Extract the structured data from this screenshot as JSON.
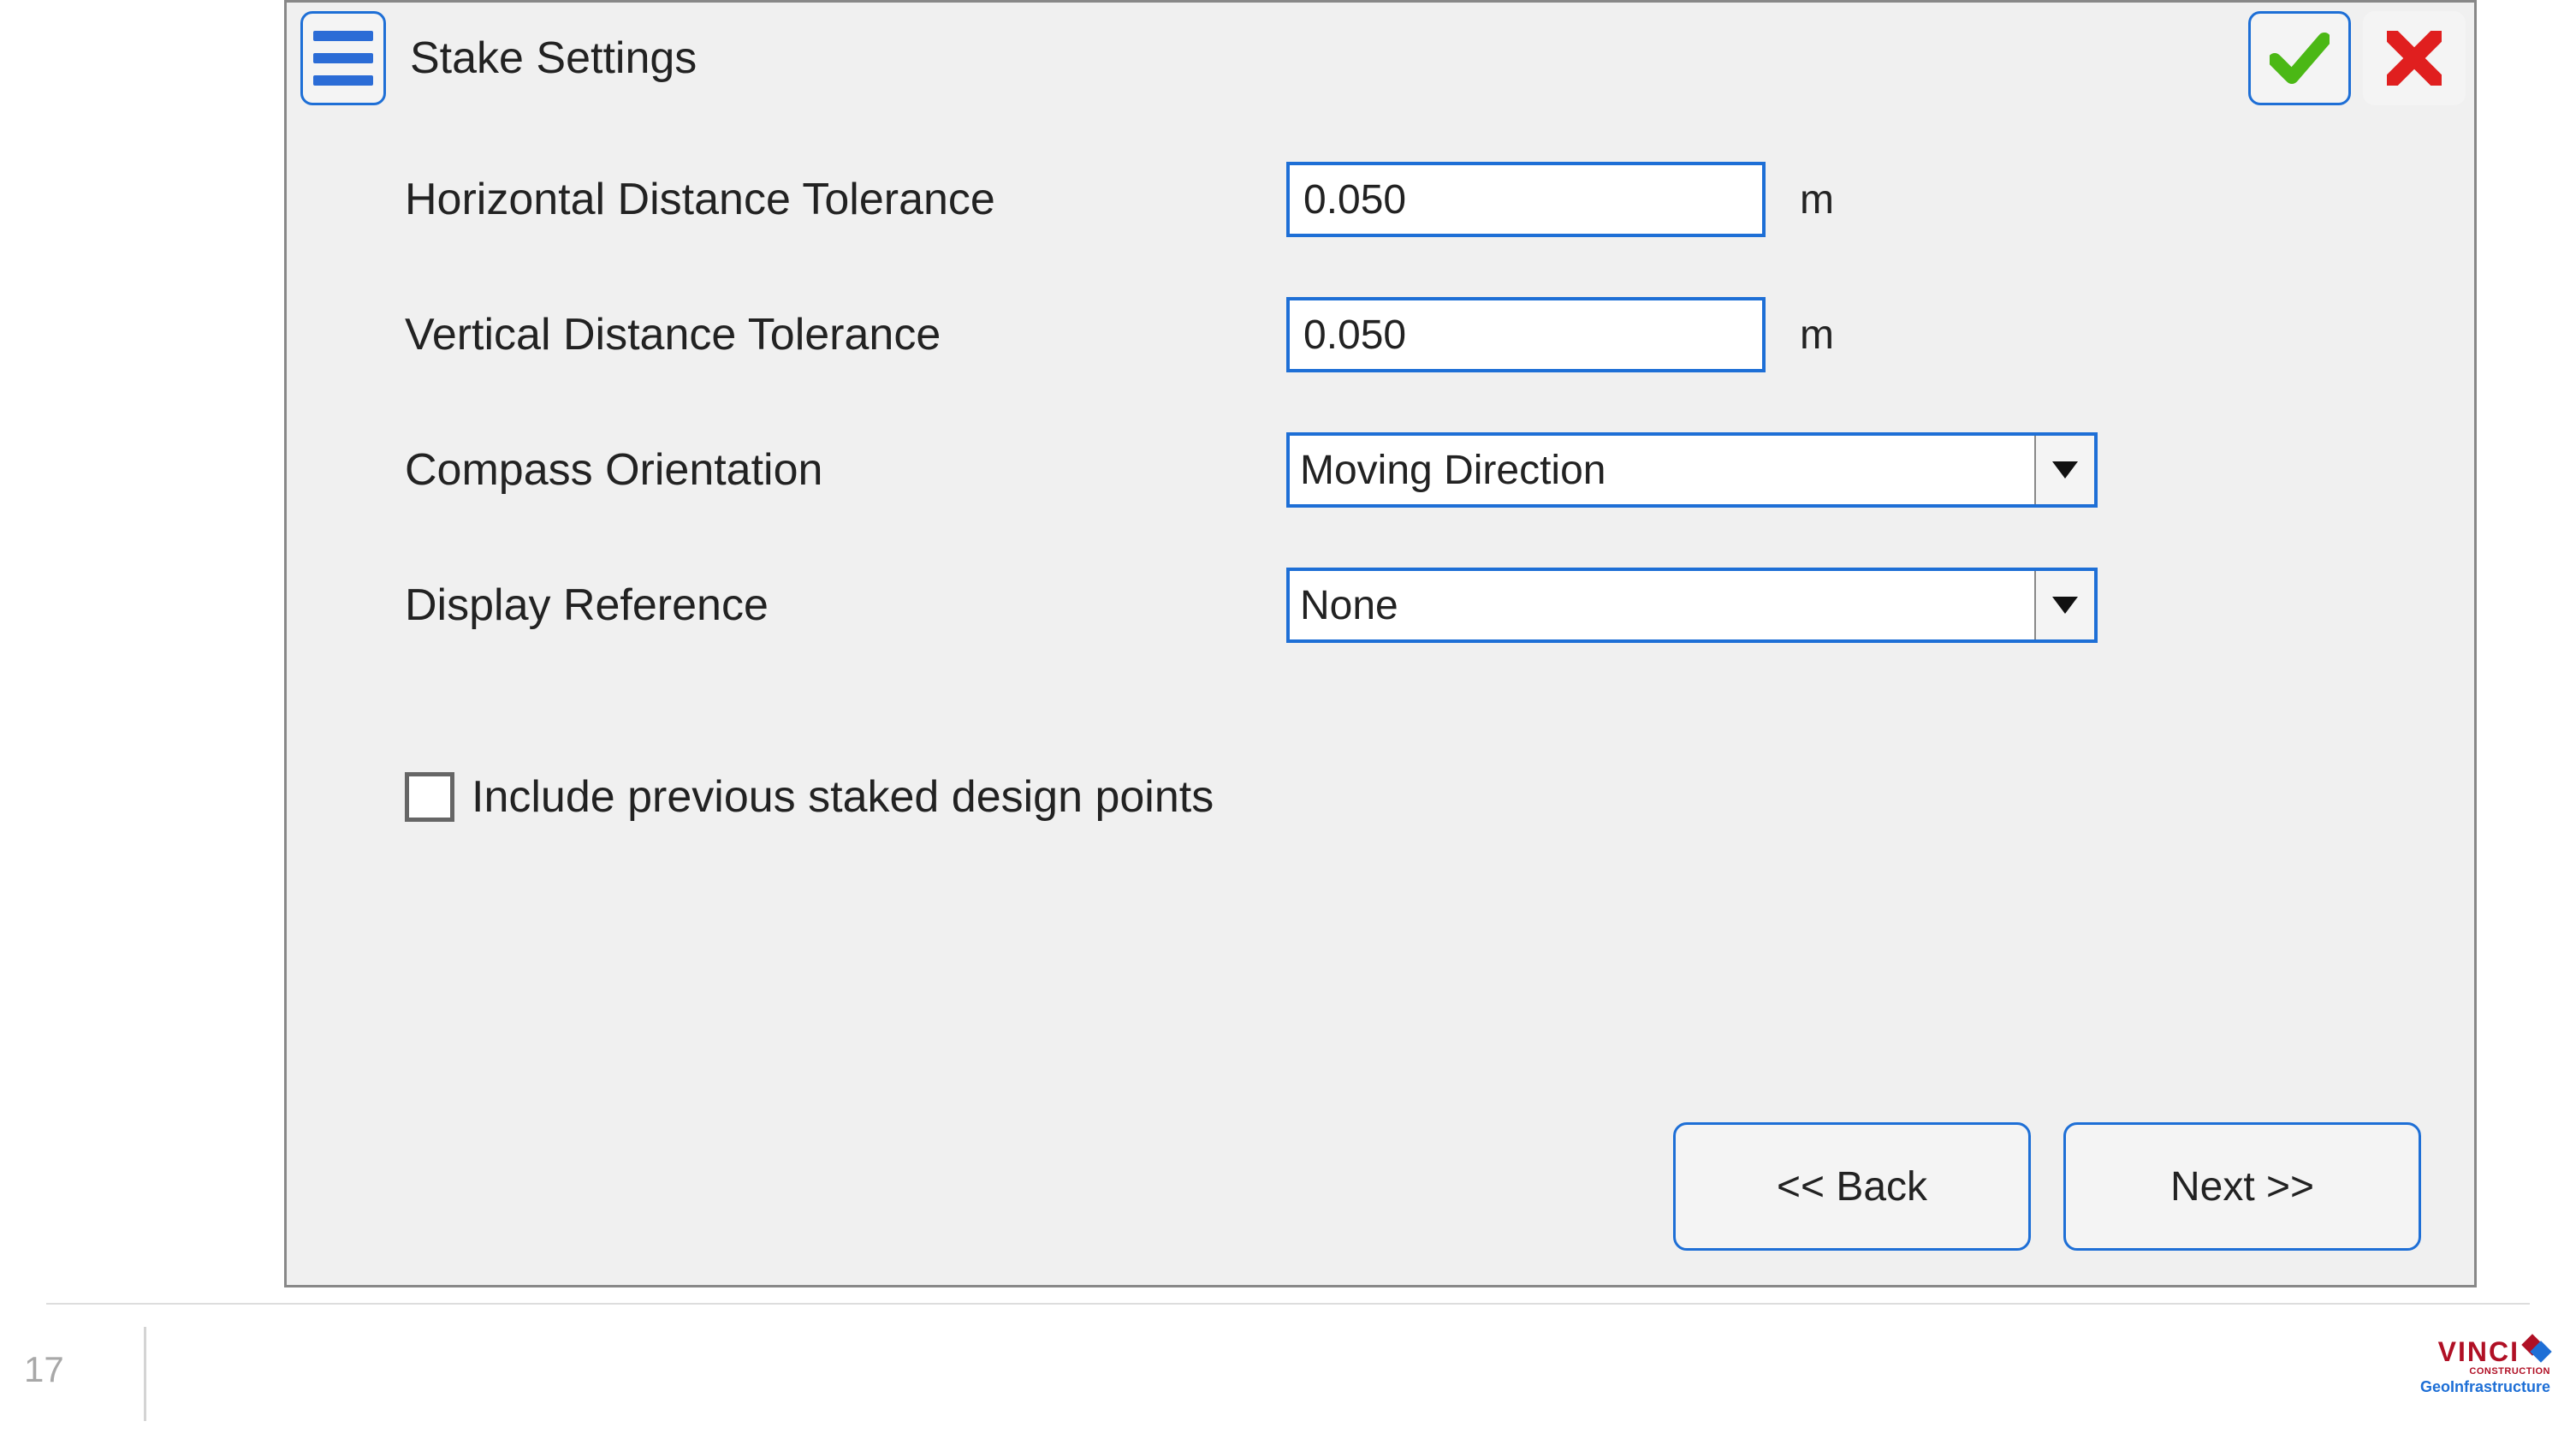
{
  "dialog": {
    "title": "Stake Settings"
  },
  "fields": {
    "h_tol": {
      "label": "Horizontal Distance Tolerance",
      "value": "0.050",
      "unit": "m"
    },
    "v_tol": {
      "label": "Vertical Distance Tolerance",
      "value": "0.050",
      "unit": "m"
    },
    "compass": {
      "label": "Compass Orientation",
      "value": "Moving Direction"
    },
    "display_ref": {
      "label": "Display Reference",
      "value": "None"
    }
  },
  "checkbox": {
    "include_prev": {
      "label": "Include previous staked design points",
      "checked": false
    }
  },
  "buttons": {
    "back": "<< Back",
    "next": "Next >>"
  },
  "footer": {
    "page_number": "17",
    "logo_main": "VINCI",
    "logo_construction": "CONSTRUCTION",
    "logo_sub": "GeoInfrastructure"
  }
}
